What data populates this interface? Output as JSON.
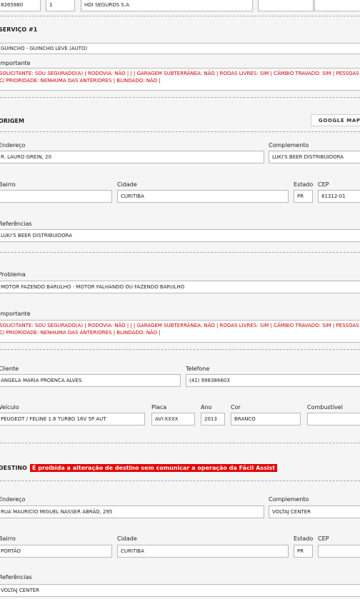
{
  "top_row": {
    "protocol": "8265880",
    "seq": "1",
    "insurer": "HDI SEGUROS S.A"
  },
  "service": {
    "title": "SERVIÇO #1",
    "type": "GUINCHO - GUINCHO LEVE (AUTO)",
    "important_label": "Importante",
    "important_text": "SOLICITANTE: SOU SEGURADO(A) | RODOVIA: NÃO | | | GARAGEM SUBTERRÂNEA: NÃO | RODAS LIVRES: SIM | CÂMBIO TRAVADO: SIM | PESSOAS C/ PRIORIDADE: NENHUMA DAS ANTERIORES | BLINDADO: NÃO |"
  },
  "origin": {
    "title": "ORIGEM",
    "maps_button": "GOOGLE MAPS",
    "address_label": "Endereço",
    "address": "R. LAURO GREIN, 20",
    "complement_label": "Complemento",
    "complement": "LUKI'S BEER DISTRIBUIDORA",
    "district_label": "Bairro",
    "district": "",
    "city_label": "Cidade",
    "city": "CURITIBA",
    "state_label": "Estado",
    "state": "PR",
    "cep_label": "CEP",
    "cep": "81312-01",
    "refs_label": "Referências",
    "refs": "LUKI'S BEER DISTRIBUIDORA"
  },
  "problem": {
    "label": "Problema",
    "value": "MOTOR FAZENDO BARULHO - MOTOR FALHANDO OU FAZENDO BARULHO",
    "important_label": "Importante",
    "important_text": "SOLICITANTE: SOU SEGURADO(A) | RODOVIA: NÃO | | | GARAGEM SUBTERRÂNEA: NÃO | RODAS LIVRES: SIM | CÂMBIO TRAVADO: SIM | PESSOAS C/ PRIORIDADE: NENHUMA DAS ANTERIORES | BLINDADO: NÃO |"
  },
  "client": {
    "label": "Cliente",
    "name": "ANGELA MARIA PROENCA ALVES",
    "phone_label": "Telefone",
    "phone": "(41) 998386603"
  },
  "vehicle": {
    "label": "Veículo",
    "model": "PEUGEOT / FELINE 1.6 TURBO 16V 5P AUT",
    "plate_label": "Placa",
    "plate": "AVI-XXXX",
    "year_label": "Ano",
    "year": "2013",
    "color_label": "Cor",
    "color": "BRANCO",
    "fuel_label": "Combustível",
    "fuel": ""
  },
  "destination": {
    "title": "DESTINO",
    "warning": "É proibida a alteração de destino sem comunicar a operação da Fácil Assist",
    "address_label": "Endereço",
    "address": "RUA MAURÍCIO MIGUEL NASSER ABRÃO, 295",
    "complement_label": "Complemento",
    "complement": "VOLTAJ CENTER",
    "district_label": "Bairro",
    "district": "PORTÃO",
    "city_label": "Cidade",
    "city": "CURITIBA",
    "state_label": "Estado",
    "state": "PR",
    "cep_label": "CEP",
    "cep": "",
    "refs_label": "Referências",
    "refs": "VOLTAJ CENTER"
  }
}
